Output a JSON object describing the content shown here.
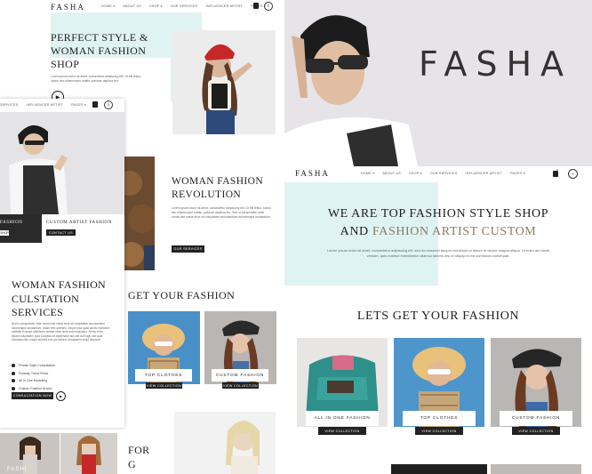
{
  "colors": {
    "mint": "#dff3f2",
    "dark": "#222222",
    "bg": "#ffffff"
  },
  "panel_a": {
    "logo": "FASHA",
    "nav": [
      "HOME ▾",
      "ABOUT US",
      "SHOP ▾",
      "OUR SERVICES",
      "INFLUENCER ARTIST",
      "PAGES ▾"
    ],
    "hero_title": "PERFECT STYLE & WOMAN FASHION SHOP",
    "hero_text": "Lorem ipsum dolor sit amet, consectetur adipiscing elit. Ut elit tellus, luctus nec ullamcorper mattis, pulvinar dapibus leo.",
    "revolution_title": "WOMAN FASHION REVOLUTION",
    "revolution_text": "Lorem ipsum dolor sit amet, consectetur adipiscing elit. Ut elit tellus, luctus nec ullamcorper mattis, pulvinar dapibus leo. Sed ut perspiciatis unde omnis iste natus error sit voluptatem accusantium doloremque laudantium.",
    "our_services_btn": "OUR SERVICES",
    "get_fashion_title": "GET YOUR FASHION",
    "cards": [
      {
        "label": "TOP CLOTHES",
        "btn": "VIEW COLLECTION"
      },
      {
        "label": "CUSTOM FASHION",
        "btn": "VIEW COLLECTION"
      }
    ],
    "for_text": "FOR",
    "g_text": "G",
    "bottom_fashion": "FASHI"
  },
  "panel_b": {
    "nav": [
      "SERVICES",
      "INFLUENCER ARTIST",
      "PAGES ▾"
    ],
    "banner_left": "FASHION",
    "banner_right": "CUSTOM ARTIST FASHION",
    "banner_btn_left": "SHOP",
    "banner_btn_right": "CONTACT US",
    "services_title": "WOMAN FASHION CULSTATION SERVICES",
    "services_text": "Sed ut perspiciatis unde omnis iste natus error sit voluptatem accusantium doloremque laudantium, totam rem aperiam, eaque ipsa quae ab illo inventore veritatis et quasi architecto beatae vitae dicta sunt explicabo. Nemo enim ipsam voluptatem quia voluptas sit aspernatur aut odit aut fugit, sed quia consequuntur magni dolores eos qui ratione voluptatem sequi nesciunt.",
    "services_list": [
      "Private Style Consultation",
      "Runway Trend Show",
      "All In One Modelling",
      "Custom Fashion Brand"
    ],
    "services_btn": "CONSULTATION NOW"
  },
  "panel_c": {
    "hero_word": "FASHA",
    "logo": "FASHA",
    "nav": [
      "HOME ▾",
      "ABOUT US",
      "SHOP ▾",
      "OUR SERVICES",
      "INFLUENCER ARTIST",
      "PAGES ▾"
    ],
    "cart_count": "0",
    "headline_1": "WE ARE TOP FASHION STYLE SHOP",
    "headline_2_plain": "AND",
    "headline_2_accent": "FASHION ARTIST CUSTOM",
    "body": "Lorem ipsum dolor sit amet, consectetur adipiscing elit, sed do eiusmod tempor incididunt ut labore et dolore magna aliqua. Ut enim ad minim veniam, quis nostrud exercitation ullamco laboris nisi ut aliquip ex ea commodo consequat.",
    "get_title": "LETS GET YOUR FASHION",
    "cards": [
      {
        "label": "ALL IN ONE FASHION",
        "btn": "VIEW COLLECTION"
      },
      {
        "label": "TOP CLOTHES",
        "btn": "VIEW COLLECTION"
      },
      {
        "label": "CUSTOM FASHION",
        "btn": "VIEW COLLECTION"
      }
    ]
  }
}
